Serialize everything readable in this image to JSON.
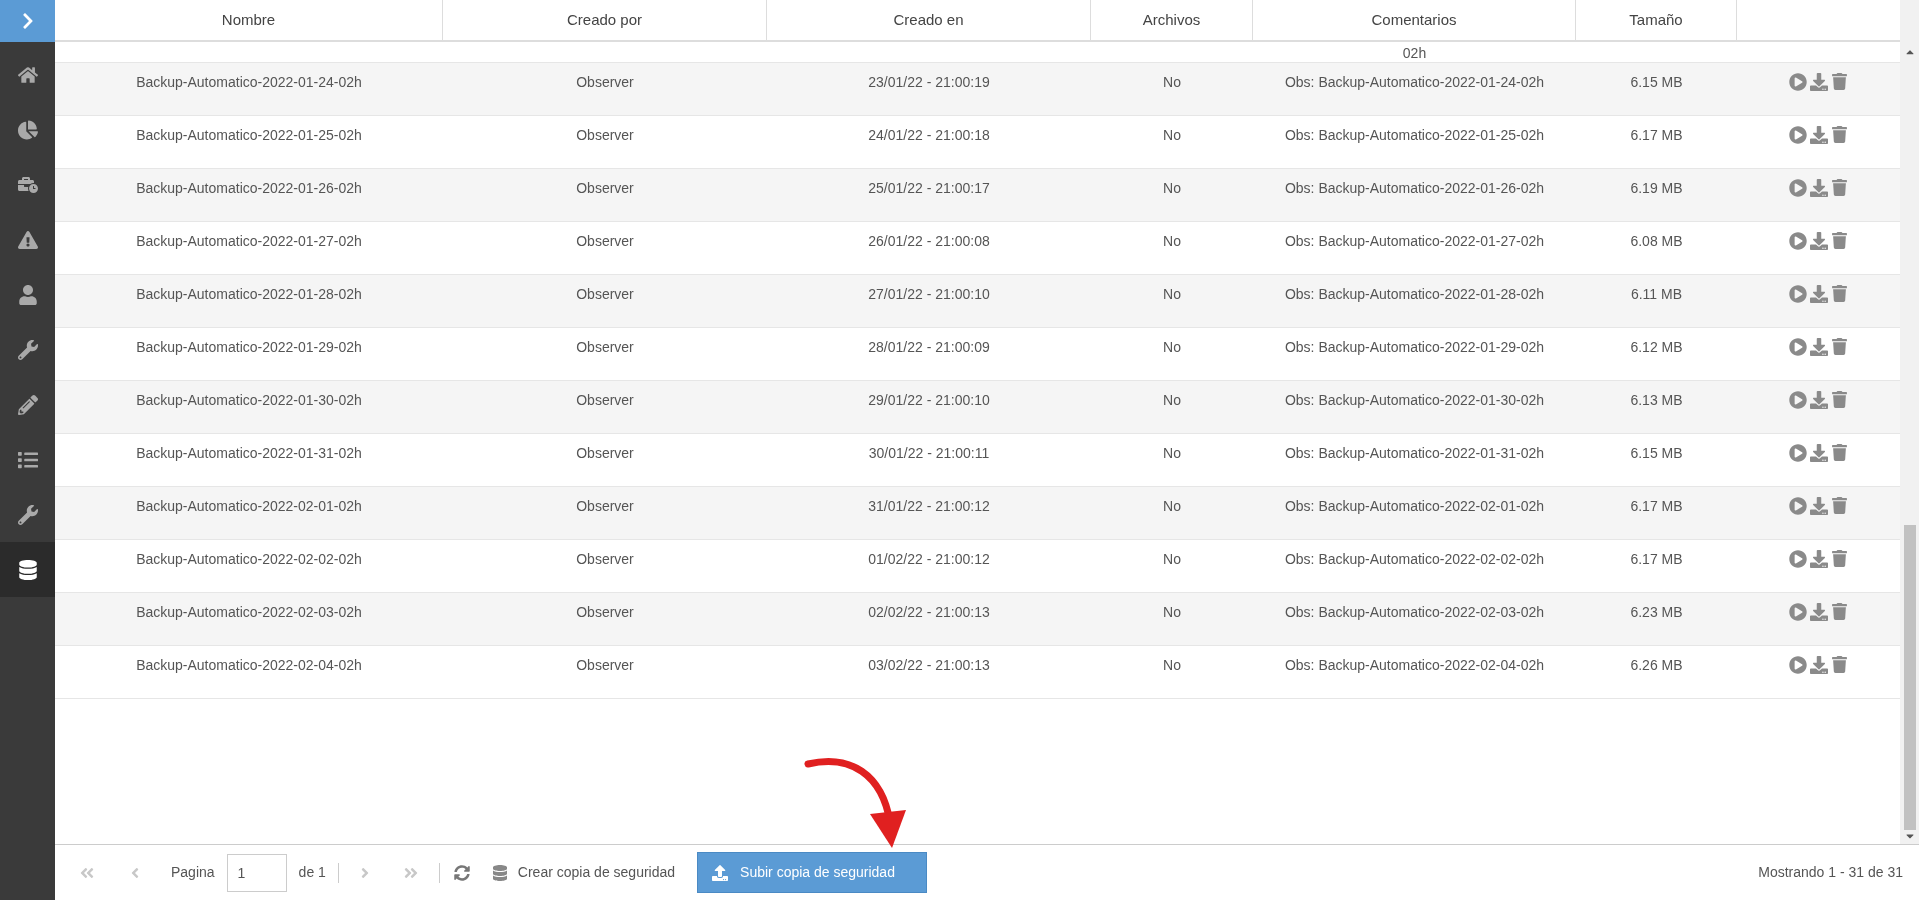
{
  "sidebar": {
    "items": [
      {
        "selected": false
      },
      {
        "selected": false
      },
      {
        "selected": false
      },
      {
        "selected": false
      },
      {
        "selected": false
      },
      {
        "selected": false
      },
      {
        "selected": false
      },
      {
        "selected": false
      },
      {
        "selected": false
      },
      {
        "selected": true
      }
    ]
  },
  "table": {
    "columns": [
      "Nombre",
      "Creado por",
      "Creado en",
      "Archivos",
      "Comentarios",
      "Tamaño"
    ],
    "partial_row": {
      "comment_tail": "02h"
    },
    "rows": [
      {
        "name": "Backup-Automatico-2022-01-24-02h",
        "creator": "Observer",
        "created": "23/01/22 - 21:00:19",
        "files": "No",
        "comment": "Obs: Backup-Automatico-2022-01-24-02h",
        "size": "6.15 MB"
      },
      {
        "name": "Backup-Automatico-2022-01-25-02h",
        "creator": "Observer",
        "created": "24/01/22 - 21:00:18",
        "files": "No",
        "comment": "Obs: Backup-Automatico-2022-01-25-02h",
        "size": "6.17 MB"
      },
      {
        "name": "Backup-Automatico-2022-01-26-02h",
        "creator": "Observer",
        "created": "25/01/22 - 21:00:17",
        "files": "No",
        "comment": "Obs: Backup-Automatico-2022-01-26-02h",
        "size": "6.19 MB"
      },
      {
        "name": "Backup-Automatico-2022-01-27-02h",
        "creator": "Observer",
        "created": "26/01/22 - 21:00:08",
        "files": "No",
        "comment": "Obs: Backup-Automatico-2022-01-27-02h",
        "size": "6.08 MB"
      },
      {
        "name": "Backup-Automatico-2022-01-28-02h",
        "creator": "Observer",
        "created": "27/01/22 - 21:00:10",
        "files": "No",
        "comment": "Obs: Backup-Automatico-2022-01-28-02h",
        "size": "6.11 MB"
      },
      {
        "name": "Backup-Automatico-2022-01-29-02h",
        "creator": "Observer",
        "created": "28/01/22 - 21:00:09",
        "files": "No",
        "comment": "Obs: Backup-Automatico-2022-01-29-02h",
        "size": "6.12 MB"
      },
      {
        "name": "Backup-Automatico-2022-01-30-02h",
        "creator": "Observer",
        "created": "29/01/22 - 21:00:10",
        "files": "No",
        "comment": "Obs: Backup-Automatico-2022-01-30-02h",
        "size": "6.13 MB"
      },
      {
        "name": "Backup-Automatico-2022-01-31-02h",
        "creator": "Observer",
        "created": "30/01/22 - 21:00:11",
        "files": "No",
        "comment": "Obs: Backup-Automatico-2022-01-31-02h",
        "size": "6.15 MB"
      },
      {
        "name": "Backup-Automatico-2022-02-01-02h",
        "creator": "Observer",
        "created": "31/01/22 - 21:00:12",
        "files": "No",
        "comment": "Obs: Backup-Automatico-2022-02-01-02h",
        "size": "6.17 MB"
      },
      {
        "name": "Backup-Automatico-2022-02-02-02h",
        "creator": "Observer",
        "created": "01/02/22 - 21:00:12",
        "files": "No",
        "comment": "Obs: Backup-Automatico-2022-02-02-02h",
        "size": "6.17 MB"
      },
      {
        "name": "Backup-Automatico-2022-02-03-02h",
        "creator": "Observer",
        "created": "02/02/22 - 21:00:13",
        "files": "No",
        "comment": "Obs: Backup-Automatico-2022-02-03-02h",
        "size": "6.23 MB"
      },
      {
        "name": "Backup-Automatico-2022-02-04-02h",
        "creator": "Observer",
        "created": "03/02/22 - 21:00:13",
        "files": "No",
        "comment": "Obs: Backup-Automatico-2022-02-04-02h",
        "size": "6.26 MB"
      }
    ]
  },
  "pager": {
    "first_disabled": true,
    "prev_disabled": true,
    "page_label": "Pagina",
    "page": "1",
    "of": "de 1",
    "next_disabled": true,
    "last_disabled": true,
    "create_label": "Crear copia de seguridad",
    "upload_label": "Subir copia de seguridad",
    "summary": "Mostrando 1 - 31 de 31"
  }
}
